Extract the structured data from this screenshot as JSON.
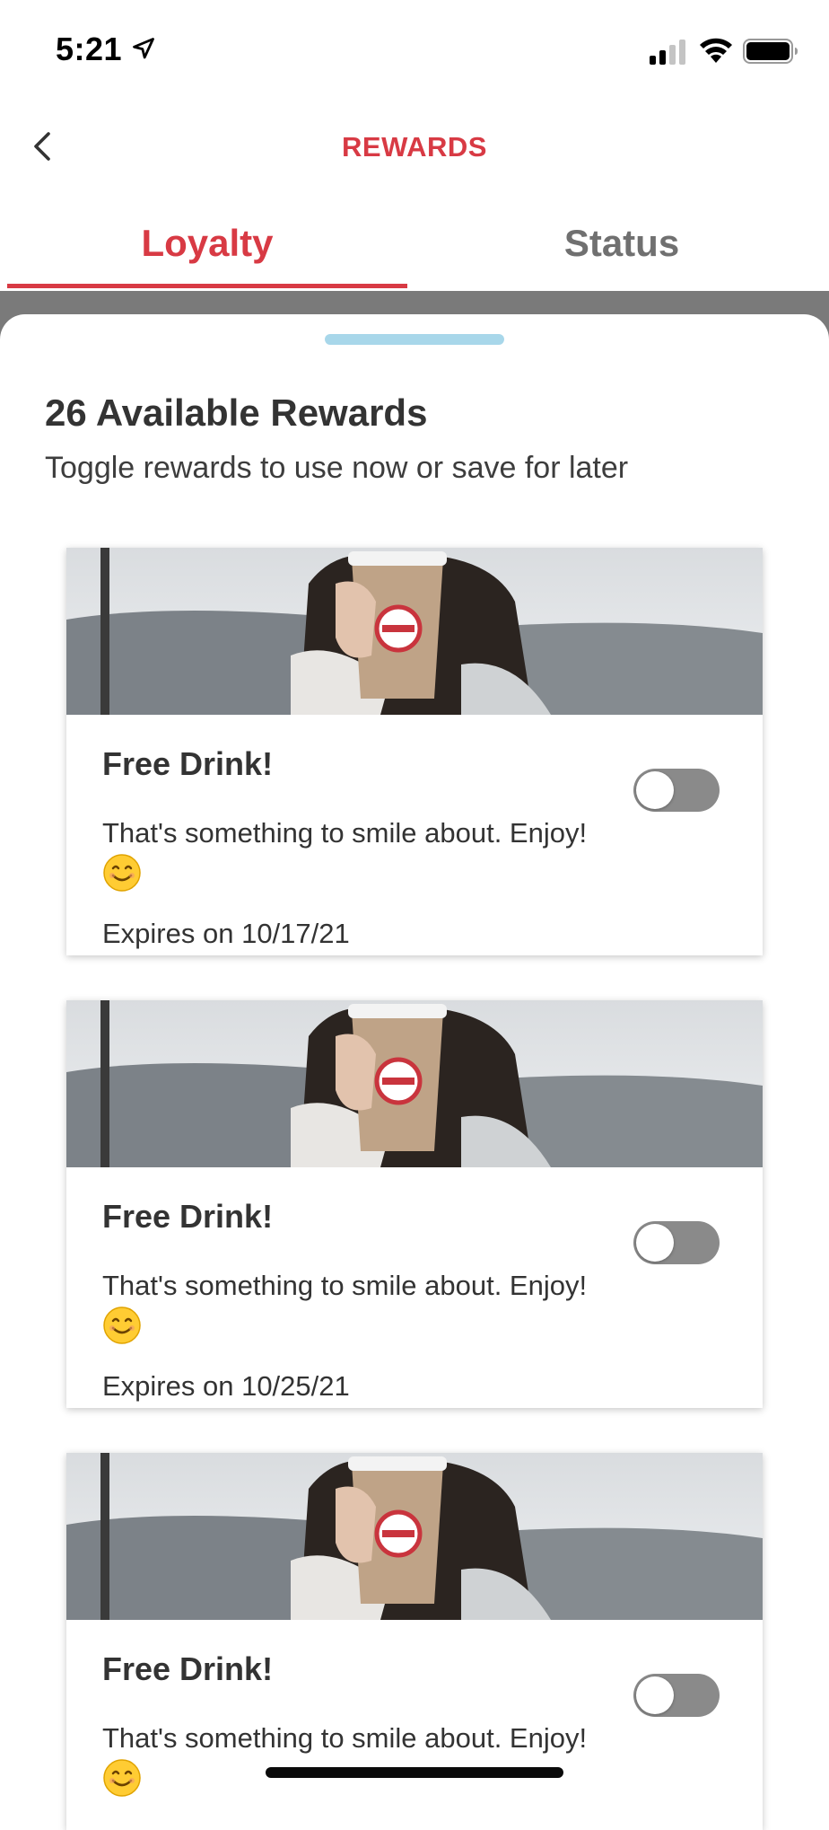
{
  "status_bar": {
    "time": "5:21"
  },
  "header": {
    "title": "REWARDS",
    "back_icon": "chevron-left-icon"
  },
  "tabs": [
    {
      "label": "Loyalty",
      "active": true
    },
    {
      "label": "Status",
      "active": false
    }
  ],
  "rewards": {
    "count_label": "26 Available Rewards",
    "subtitle": "Toggle rewards to use now or save for later",
    "cards": [
      {
        "title": "Free Drink!",
        "description": "That's something to smile about. Enjoy!",
        "emoji": "smiling-face-icon",
        "expiry": "Expires on 10/17/21",
        "enabled": false
      },
      {
        "title": "Free Drink!",
        "description": "That's something to smile about. Enjoy!",
        "emoji": "smiling-face-icon",
        "expiry": "Expires on 10/25/21",
        "enabled": false
      },
      {
        "title": "Free Drink!",
        "description": "That's something to smile about. Enjoy!",
        "emoji": "smiling-face-icon",
        "expiry": "",
        "enabled": false
      }
    ]
  },
  "colors": {
    "accent": "#d83a44",
    "tab_inactive": "#707070",
    "handle": "#a8d7ea",
    "toggle_off": "#8a8a8a"
  }
}
